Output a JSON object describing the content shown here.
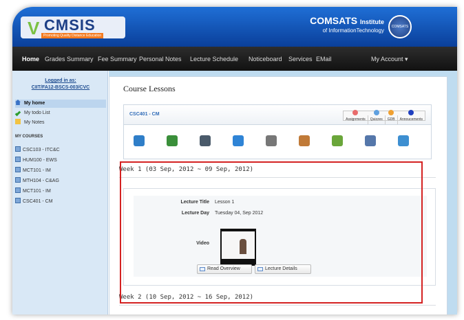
{
  "brand": {
    "logo_text": "CMSIS",
    "logo_letter": "V",
    "logo_tagline": "Promoting Quality Distance Education",
    "institute_name": "COMSATS",
    "institute_word": "Institute",
    "institute_sub": "of InformationTechnology",
    "seal_text": "COMSATS"
  },
  "nav": {
    "items": [
      "Home",
      "Grades Summary",
      "Fee Summary",
      "Personal Notes",
      "Lecture Schedule",
      "Noticeboard",
      "Services",
      "EMail"
    ],
    "account": "My Account ▾"
  },
  "sidebar": {
    "logged_in_label": "Logged in as:",
    "user_id": "CIIT/FA12-BSCS-003/CVC",
    "menu": [
      "My home",
      "My todo List",
      "My Notes"
    ],
    "courses_header": "MY COURSES",
    "courses": [
      "CSC103 - ITC&C",
      "HUM100 - EWS",
      "MCT101 - IM",
      "MTH104 - C&AG",
      "MCT101 - IM",
      "CSC401 - CM"
    ]
  },
  "content": {
    "title": "Course Lessons",
    "course_code": "CSC401 - CM",
    "tabs": [
      {
        "label": "Assignments",
        "badge_color": "#e86b6b"
      },
      {
        "label": "Quizzes",
        "badge_color": "#5fa0df"
      },
      {
        "label": "GDB",
        "badge_color": "#f0a030"
      },
      {
        "label": "Annoucements",
        "badge_color": "#1f3fbf"
      }
    ],
    "tools": [
      {
        "icon": "new-document-icon",
        "color": "#2f7ec8"
      },
      {
        "icon": "blackboard-icon",
        "color": "#3a8f3a"
      },
      {
        "icon": "video-camera-icon",
        "color": "#4a5a6a"
      },
      {
        "icon": "help-icon",
        "color": "#2f84d6"
      },
      {
        "icon": "notebook-icon",
        "color": "#777777"
      },
      {
        "icon": "group-icon",
        "color": "#c07a38"
      },
      {
        "icon": "people-icon",
        "color": "#6aa63a"
      },
      {
        "icon": "projector-icon",
        "color": "#5577aa"
      },
      {
        "icon": "disk-icon",
        "color": "#3d8fd1"
      }
    ],
    "week1": "Week 1 (03 Sep, 2012 ~ 09 Sep, 2012)",
    "week2": "Week 2 (10 Sep, 2012 ~ 16 Sep, 2012)",
    "lecture_title_label": "Lecture Title",
    "lecture_title": "Lesson 1",
    "lecture_day_label": "Lecture Day",
    "lecture_day": "Tuesday 04, Sep 2012",
    "video_label": "Video",
    "read_overview": "Read Overview",
    "lecture_details": "Lecture Details"
  }
}
